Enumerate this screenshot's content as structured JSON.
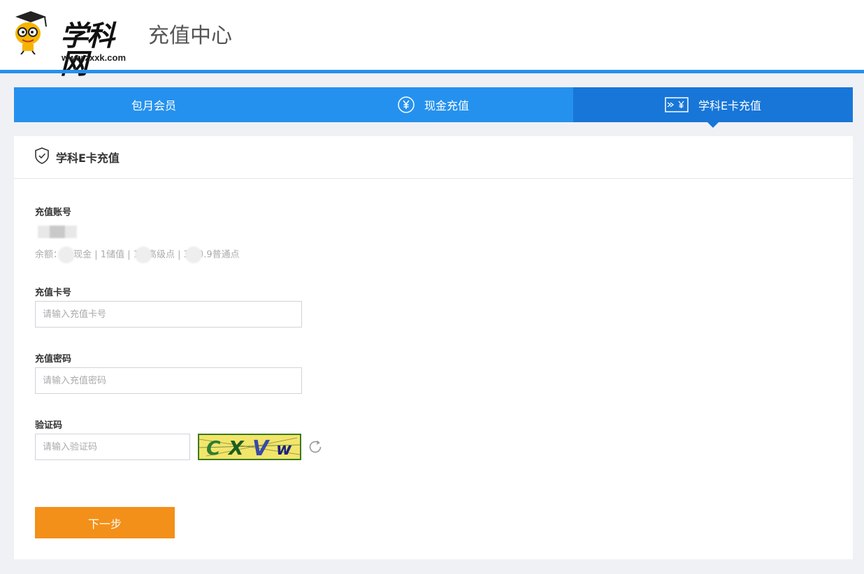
{
  "header": {
    "logo_text": "学科网",
    "logo_url": "www.zxxk.com",
    "page_title": "充值中心"
  },
  "tabs": [
    {
      "label": "包月会员",
      "icon": "none",
      "active": false
    },
    {
      "label": "现金充值",
      "icon": "yuan-circle-icon",
      "active": false
    },
    {
      "label": "学科E卡充值",
      "icon": "card-yuan-icon",
      "active": true
    }
  ],
  "panel": {
    "title": "学科E卡充值",
    "account_label": "充值账号",
    "balance_prefix": "余额：",
    "balance_part1": "现金 | 1储值 | 1",
    "balance_part2": "高级点 | 3",
    "balance_part3": "0.9普通点",
    "card_label": "充值卡号",
    "card_placeholder": "请输入充值卡号",
    "password_label": "充值密码",
    "password_placeholder": "请输入充值密码",
    "captcha_label": "验证码",
    "captcha_placeholder": "请输入验证码",
    "captcha_text": "CXVw",
    "next_label": "下一步"
  },
  "colors": {
    "primary": "#2591ee",
    "active_tab": "#1776d8",
    "button": "#f39019"
  }
}
